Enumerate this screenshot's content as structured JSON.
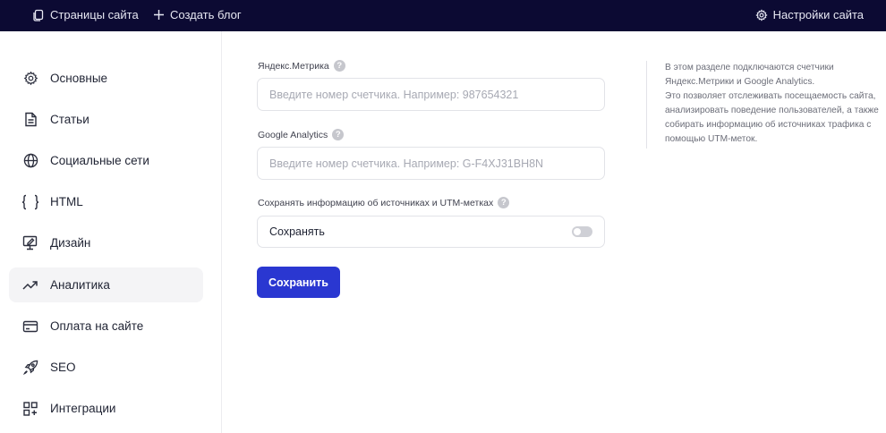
{
  "topbar": {
    "pages_label": "Страницы сайта",
    "create_blog_label": "Создать блог",
    "settings_label": "Настройки сайта"
  },
  "sidebar": {
    "items": [
      {
        "label": "Основные",
        "icon": "gear-icon"
      },
      {
        "label": "Статьи",
        "icon": "document-icon"
      },
      {
        "label": "Социальные сети",
        "icon": "globe-icon"
      },
      {
        "label": "HTML",
        "icon": "braces-icon"
      },
      {
        "label": "Дизайн",
        "icon": "design-icon"
      },
      {
        "label": "Аналитика",
        "icon": "trend-up-icon",
        "active": true
      },
      {
        "label": "Оплата на сайте",
        "icon": "credit-card-icon"
      },
      {
        "label": "SEO",
        "icon": "rocket-icon"
      },
      {
        "label": "Интеграции",
        "icon": "integrations-icon"
      }
    ]
  },
  "form": {
    "yandex": {
      "label": "Яндекс.Метрика",
      "value": "",
      "placeholder": "Введите номер счетчика. Например: 987654321"
    },
    "google": {
      "label": "Google Analytics",
      "value": "",
      "placeholder": "Введите номер счетчика. Например: G-F4XJ31BH8N"
    },
    "utm": {
      "label": "Сохранять информацию об источниках и UTM-метках",
      "toggle_label": "Сохранять",
      "enabled": false
    },
    "save_label": "Сохранить",
    "help_glyph": "?"
  },
  "info": {
    "lines": [
      "В этом разделе подключаются счетчики",
      "Яндекс.Метрики и Google Analytics.",
      "Это позволяет отслеживать посещаемость сайта,",
      "анализировать поведение пользователей, а также",
      "собирать информацию об источниках трафика с",
      "помощью UTM-меток."
    ]
  },
  "colors": {
    "topbar_bg": "#0c0a33",
    "accent": "#2a37d1",
    "active_item_bg": "#f4f4f6"
  }
}
